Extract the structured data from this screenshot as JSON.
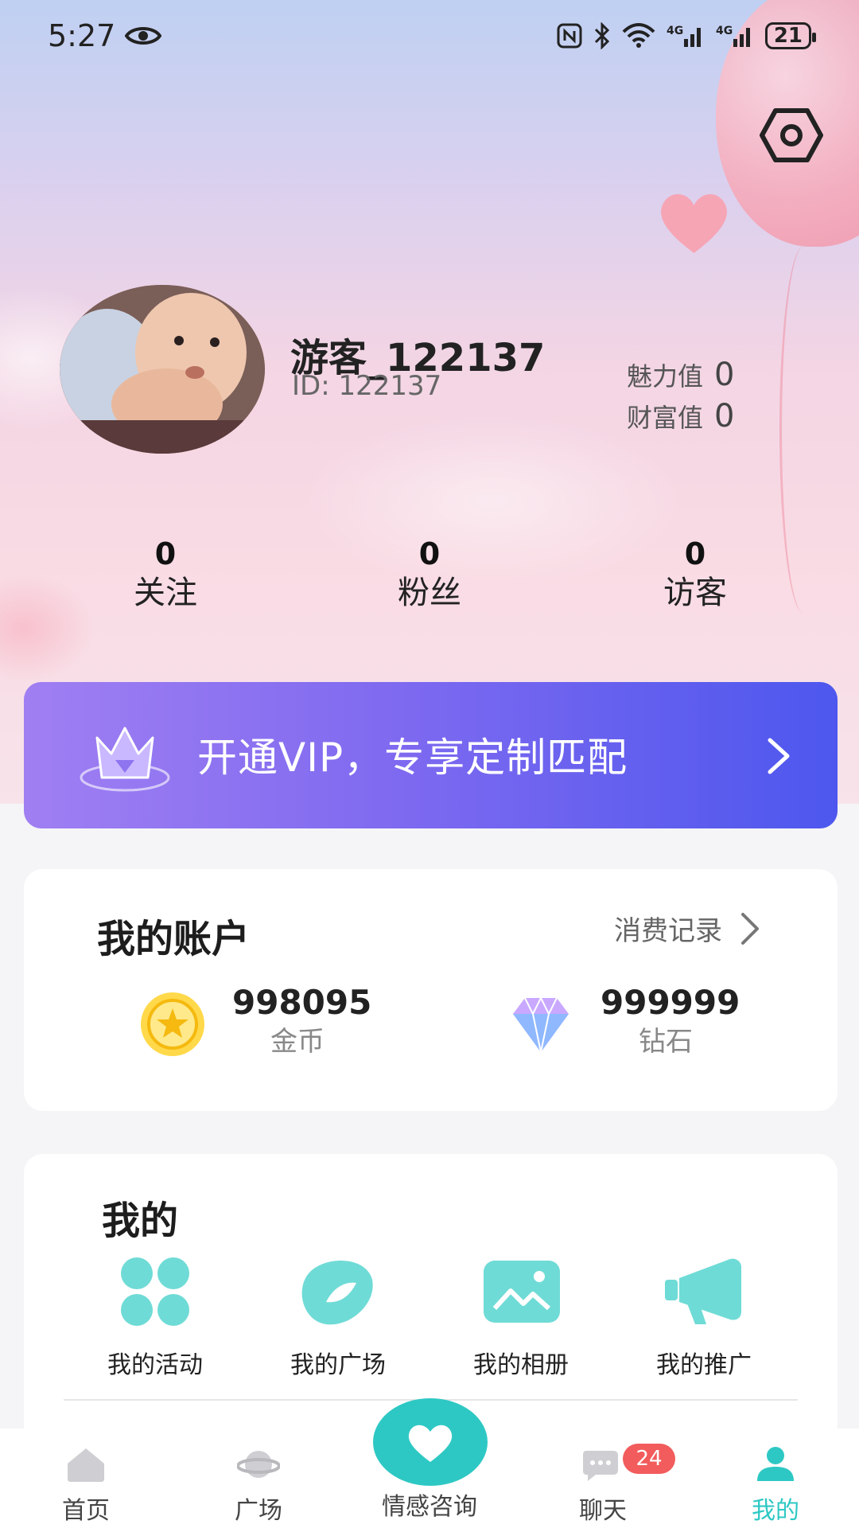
{
  "status_bar": {
    "time": "5:27",
    "battery": "21"
  },
  "profile": {
    "username": "游客_122137",
    "id_text": "ID: 122137",
    "charm_label": "魅力值",
    "charm_value": "0",
    "wealth_label": "财富值",
    "wealth_value": "0"
  },
  "follow_stats": [
    {
      "count": "0",
      "label": "关注"
    },
    {
      "count": "0",
      "label": "粉丝"
    },
    {
      "count": "0",
      "label": "访客"
    }
  ],
  "vip_banner": {
    "text": "开通VIP，专享定制匹配"
  },
  "account": {
    "title": "我的账户",
    "records_label": "消费记录",
    "coins_value": "998095",
    "coins_label": "金币",
    "diamonds_value": "999999",
    "diamonds_label": "钻石"
  },
  "my_section": {
    "title": "我的",
    "items": [
      {
        "label": "我的活动",
        "icon": "clover-icon"
      },
      {
        "label": "我的广场",
        "icon": "leaf-icon"
      },
      {
        "label": "我的相册",
        "icon": "photo-album-icon"
      },
      {
        "label": "我的推广",
        "icon": "megaphone-icon"
      }
    ]
  },
  "bottom_nav": {
    "items": [
      {
        "label": "首页",
        "icon": "home-icon"
      },
      {
        "label": "广场",
        "icon": "planet-icon"
      },
      {
        "label": "情感咨询",
        "icon": "heart-icon"
      },
      {
        "label": "聊天",
        "icon": "chat-icon"
      },
      {
        "label": "我的",
        "icon": "user-icon"
      }
    ],
    "chat_badge": "24",
    "active": "我的"
  },
  "colors": {
    "accent": "#2ec8c4",
    "vip_start": "#a07ff2",
    "vip_end": "#4d57ee",
    "badge": "#f25c5c"
  }
}
